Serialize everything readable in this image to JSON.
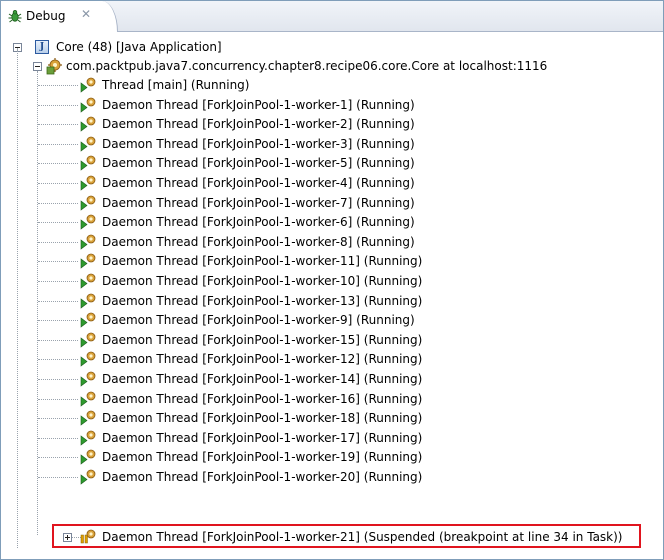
{
  "tab": {
    "label": "Debug",
    "close_glyph": "✕"
  },
  "tree": {
    "launch": {
      "label": "Core (48) [Java Application]",
      "icon": "java-app-icon"
    },
    "vm": {
      "label": "com.packtpub.java7.concurrency.chapter8.recipe06.core.Core at localhost:1116",
      "icon": "debug-target-icon"
    },
    "threads": [
      "Thread [main] (Running)",
      "Daemon Thread [ForkJoinPool-1-worker-1] (Running)",
      "Daemon Thread [ForkJoinPool-1-worker-2] (Running)",
      "Daemon Thread [ForkJoinPool-1-worker-3] (Running)",
      "Daemon Thread [ForkJoinPool-1-worker-5] (Running)",
      "Daemon Thread [ForkJoinPool-1-worker-4] (Running)",
      "Daemon Thread [ForkJoinPool-1-worker-7] (Running)",
      "Daemon Thread [ForkJoinPool-1-worker-6] (Running)",
      "Daemon Thread [ForkJoinPool-1-worker-8] (Running)",
      "Daemon Thread [ForkJoinPool-1-worker-11] (Running)",
      "Daemon Thread [ForkJoinPool-1-worker-10] (Running)",
      "Daemon Thread [ForkJoinPool-1-worker-13] (Running)",
      "Daemon Thread [ForkJoinPool-1-worker-9] (Running)",
      "Daemon Thread [ForkJoinPool-1-worker-15] (Running)",
      "Daemon Thread [ForkJoinPool-1-worker-12] (Running)",
      "Daemon Thread [ForkJoinPool-1-worker-14] (Running)",
      "Daemon Thread [ForkJoinPool-1-worker-16] (Running)",
      "Daemon Thread [ForkJoinPool-1-worker-18] (Running)",
      "Daemon Thread [ForkJoinPool-1-worker-17] (Running)",
      "Daemon Thread [ForkJoinPool-1-worker-19] (Running)",
      "Daemon Thread [ForkJoinPool-1-worker-20] (Running)"
    ],
    "suspended_thread": "Daemon Thread [ForkJoinPool-1-worker-21] (Suspended (breakpoint at line 34 in Task))"
  },
  "colors": {
    "highlight": "#e0141e",
    "running": "#2e9a2e",
    "suspended": "#e0a000"
  }
}
